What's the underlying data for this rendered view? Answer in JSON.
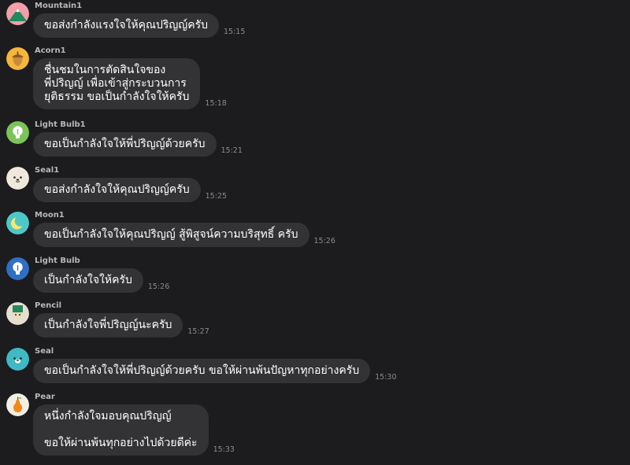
{
  "messages": [
    {
      "sender": "Mountain1",
      "avatar_icon": "mountain-icon",
      "text": "ขอส่งกำลังแรงใจให้คุณปริญญ์ครับ",
      "time": "15:15"
    },
    {
      "sender": "Acorn1",
      "avatar_icon": "acorn-icon",
      "text": "ชื่นชมในการตัดสินใจของ\nพี่ปริญญ์ เพื่อเข้าสู่กระบวนการ\nยุติธรรม ขอเป็นกำลังใจให้ครับ",
      "time": "15:18"
    },
    {
      "sender": "Light Bulb1",
      "avatar_icon": "light-bulb-icon",
      "text": "ขอเป็นกำลังใจให้พี่ปริญญ์ด้วยครับ",
      "time": "15:21"
    },
    {
      "sender": "Seal1",
      "avatar_icon": "seal-icon",
      "text": "ขอส่งกำลังใจให้คุณปริญญ์ครับ",
      "time": "15:25"
    },
    {
      "sender": "Moon1",
      "avatar_icon": "moon-icon",
      "text": "ขอเป็นกำลังใจให้คุณปริญญ์ สู้พิสูจน์ความบริสุทธิ์ ครับ",
      "time": "15:26"
    },
    {
      "sender": "Light Bulb",
      "avatar_icon": "light-bulb-icon",
      "text": "เป็นกำลังใจให้ครับ",
      "time": "15:26"
    },
    {
      "sender": "Pencil",
      "avatar_icon": "pencil-icon",
      "text": "เป็นกำลังใจพี่ปริญญ์นะครับ",
      "time": "15:27"
    },
    {
      "sender": "Seal",
      "avatar_icon": "seal-icon",
      "text": "ขอเป็นกำลังใจให้พี่ปริญญ์ด้วยครับ  ขอให้ผ่านพ้นปัญหาทุกอย่างครับ",
      "time": "15:30"
    },
    {
      "sender": "Pear",
      "avatar_icon": "pear-icon",
      "text": "หนึ่งกำลังใจมอบคุณปริญญ์\n\nขอให้ผ่านพ้นทุกอย่างไปด้วยดีค่ะ",
      "time": "15:33"
    }
  ],
  "colors": {
    "background": "#1c1c1e",
    "bubble": "#333335",
    "sender_name": "#b8b8b8",
    "timestamp": "#8a8a8e"
  }
}
